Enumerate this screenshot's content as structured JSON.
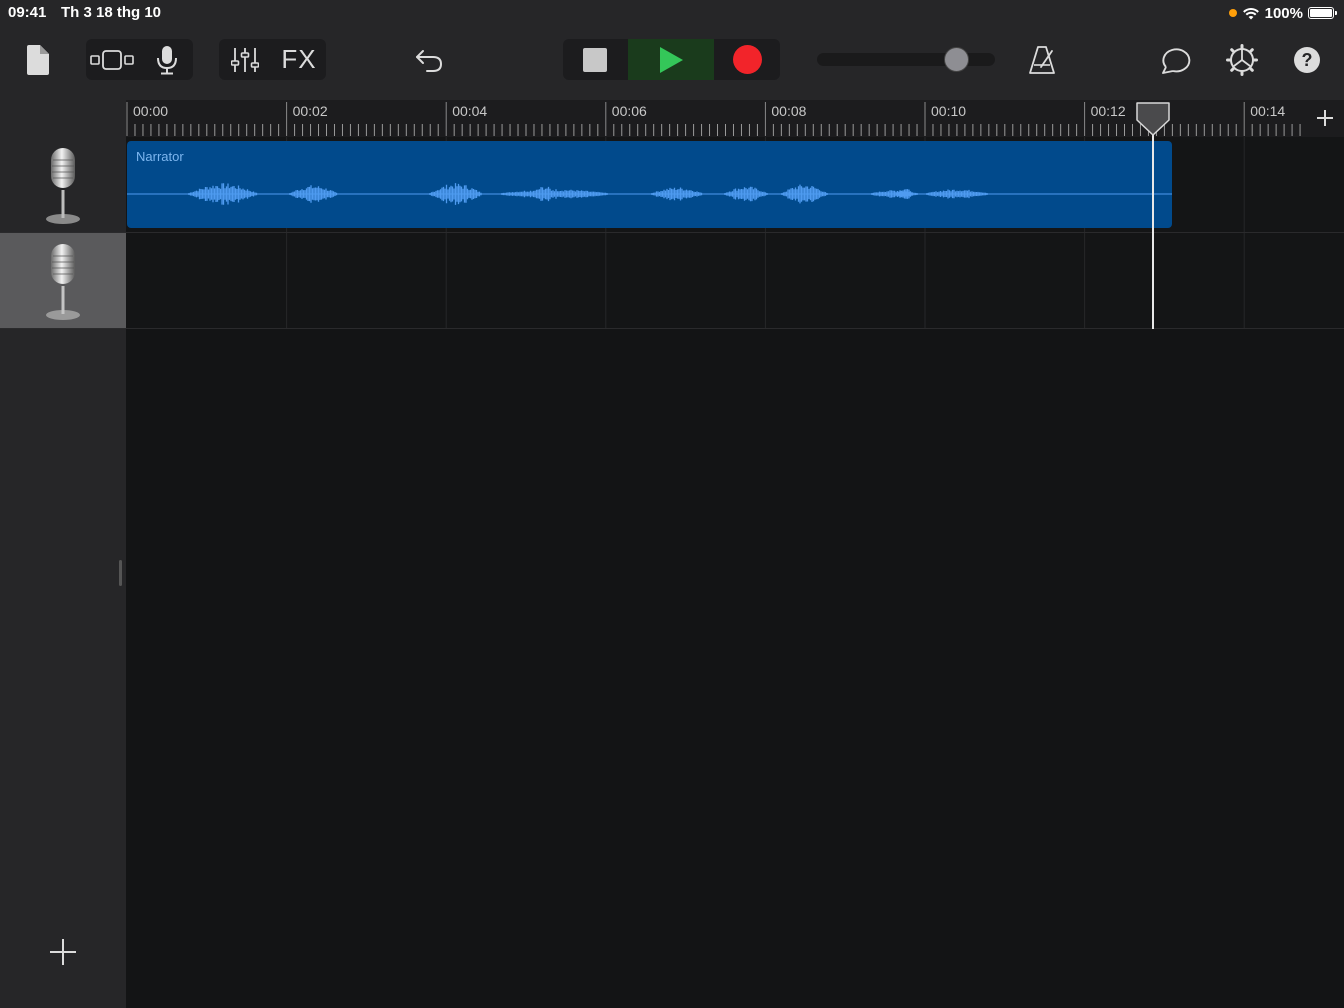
{
  "status_bar": {
    "time": "09:41",
    "date": "Th 3 18 thg 10",
    "battery": "100%",
    "battery_level": 1.0,
    "mic_indicator_color": "#ff9f0a"
  },
  "toolbar": {
    "fx_label": "FX",
    "icons": [
      "my-songs-icon",
      "view-icon",
      "microphone-icon",
      "mixer-icon",
      "undo-icon",
      "stop-icon",
      "play-icon",
      "record-icon",
      "metronome-icon",
      "loop-icon",
      "settings-icon",
      "help-icon"
    ],
    "master_volume": 0.78,
    "play_color": "#34c759",
    "record_color": "#f2242a"
  },
  "timeline": {
    "ruler_labels": [
      "00:00",
      "00:02",
      "00:04",
      "00:06",
      "00:08",
      "00:10",
      "00:12",
      "00:14"
    ],
    "playhead_time_s": 12.85
  },
  "tracks": [
    {
      "instrument": "audio-recorder",
      "icon": "microphone-icon",
      "selected": false
    },
    {
      "instrument": "audio-recorder",
      "icon": "microphone-icon",
      "selected": true
    }
  ],
  "regions": [
    {
      "track": 0,
      "name": "Narrator",
      "start_s": 0,
      "end_s": 13.1,
      "color": "#014a8c",
      "waveform_color": "#4f9bf0"
    }
  ]
}
